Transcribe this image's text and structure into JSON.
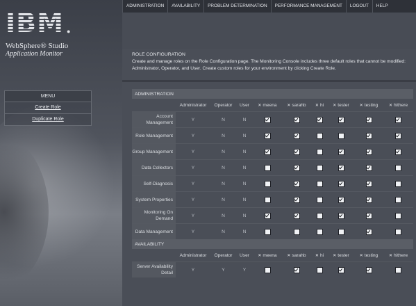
{
  "nav": [
    "ADMINISTRATION",
    "AVAILABILITY",
    "PROBLEM DETERMINATION",
    "PERFORMANCE MANAGEMENT",
    "LOGOUT",
    "HELP"
  ],
  "logo": {
    "brand": "IBM",
    "product_line1": "WebSphere® Studio",
    "product_line2": "Application Monitor"
  },
  "menu": {
    "header": "MENU",
    "items": [
      "Create Role",
      "Duplicate Role"
    ]
  },
  "page": {
    "title": "ROLE CONFIGURATION",
    "description": "Create and manage roles on the Role Configuration page. The Monitoring Console includes three default roles that cannot be modified: Administrator, Operator, and User. Create custom roles for your environment by clicking Create Role."
  },
  "columns": {
    "default_roles": [
      "Administrator",
      "Operator",
      "User"
    ],
    "custom_roles": [
      "meena",
      "sarahb",
      "hi",
      "tester",
      "testing",
      "hithere"
    ]
  },
  "sections": [
    {
      "name": "ADMINISTRATION",
      "rows": [
        {
          "label": "Account Management",
          "defaults": [
            "Y",
            "N",
            "N"
          ],
          "checks": [
            true,
            true,
            true,
            true,
            true,
            true
          ]
        },
        {
          "label": "Role Management",
          "defaults": [
            "Y",
            "N",
            "N"
          ],
          "checks": [
            true,
            true,
            false,
            false,
            true,
            true
          ]
        },
        {
          "label": "Group Management",
          "defaults": [
            "Y",
            "N",
            "N"
          ],
          "checks": [
            true,
            true,
            false,
            true,
            true,
            true
          ]
        },
        {
          "label": "Data Collectors",
          "defaults": [
            "Y",
            "N",
            "N"
          ],
          "checks": [
            false,
            true,
            false,
            true,
            true,
            false
          ]
        },
        {
          "label": "Self-Diagnosis",
          "defaults": [
            "Y",
            "N",
            "N"
          ],
          "checks": [
            false,
            true,
            false,
            true,
            true,
            false
          ]
        },
        {
          "label": "System Properties",
          "defaults": [
            "Y",
            "N",
            "N"
          ],
          "checks": [
            false,
            true,
            false,
            true,
            true,
            false
          ]
        },
        {
          "label": "Monitoring On Demand",
          "defaults": [
            "Y",
            "N",
            "N"
          ],
          "checks": [
            true,
            true,
            false,
            true,
            true,
            false
          ]
        },
        {
          "label": "Data Management",
          "defaults": [
            "Y",
            "N",
            "N"
          ],
          "checks": [
            false,
            false,
            false,
            false,
            true,
            false
          ]
        }
      ]
    },
    {
      "name": "AVAILABILITY",
      "rows": [
        {
          "label": "Server Availability Detail",
          "defaults": [
            "Y",
            "Y",
            "Y"
          ],
          "checks": [
            false,
            true,
            false,
            true,
            true,
            false
          ]
        }
      ]
    }
  ]
}
